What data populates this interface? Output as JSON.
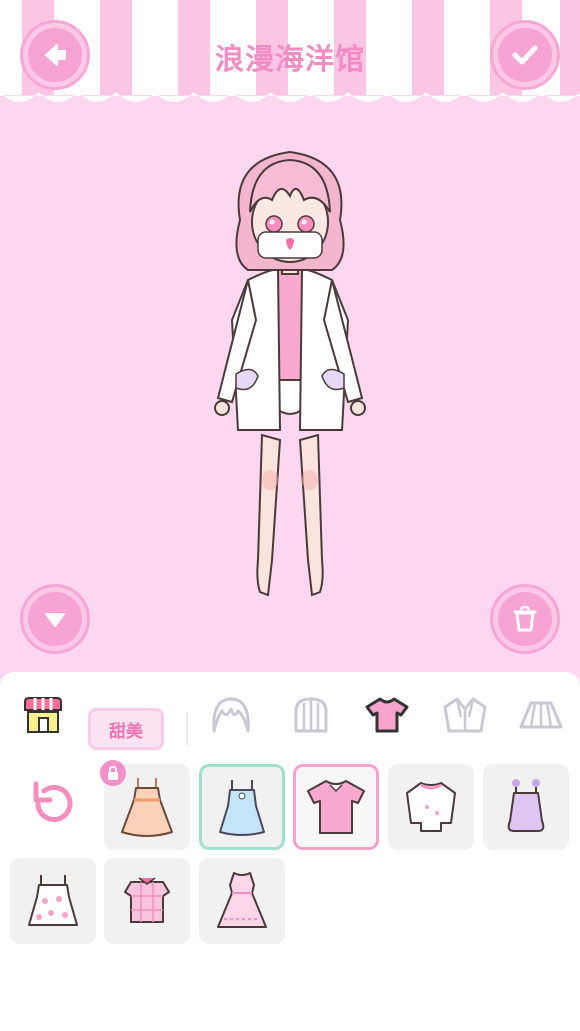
{
  "header": {
    "title": "浪漫海洋馆",
    "back_icon": "arrow-left-icon",
    "confirm_icon": "checkmark-icon"
  },
  "stage": {
    "collapse_icon": "triangle-down-icon",
    "trash_icon": "trash-icon"
  },
  "categories": {
    "shop_icon": "shop-icon",
    "style_tag": "甜美",
    "items": [
      "hair-front-icon",
      "hair-back-icon",
      "top-icon",
      "jacket-icon",
      "skirt-icon"
    ],
    "selected": "top-icon"
  },
  "items": [
    {
      "icon": "orange-dress-icon",
      "locked": true
    },
    {
      "icon": "blue-camisole-dress-icon",
      "selected": "green"
    },
    {
      "icon": "pink-tshirt-icon",
      "selected": "pink"
    },
    {
      "icon": "white-ruffle-top-icon"
    },
    {
      "icon": "purple-camisole-icon"
    },
    {
      "icon": "white-polka-dot-camisole-icon"
    },
    {
      "icon": "pink-plaid-top-icon"
    },
    {
      "icon": "pink-lace-dress-icon"
    }
  ],
  "colors": {
    "stage_bg": "#fdd7ef",
    "accent_pink": "#f7a3d3",
    "title_pink": "#f28cc5",
    "selected_green": "#9fe0cf"
  }
}
